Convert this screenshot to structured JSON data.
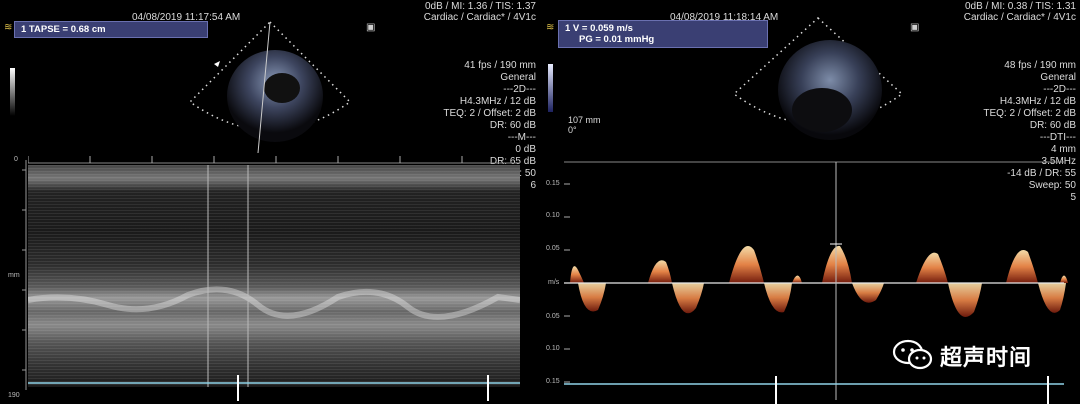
{
  "left": {
    "date": "04/08/2019 11:17:54 AM",
    "header_right": [
      "0dB / MI: 1.36 / TIS: 1.37",
      "Cardiac / Cardiac* / 4V1c"
    ],
    "measurement": "1  TAPSE = 0.68 cm",
    "params": [
      "41 fps / 190 mm",
      "General",
      "---2D---",
      "H4.3MHz / 12 dB",
      "TEQ: 2 / Offset: 2 dB",
      "DR: 60 dB",
      "---M---",
      "0 dB",
      "DR: 65 dB",
      "Sweep: 50",
      "6"
    ],
    "depth_top": "0",
    "depth_unit": "mm",
    "depth_bottom": "190"
  },
  "right": {
    "date": "04/08/2019 11:18:14 AM",
    "header_right": [
      "0dB / MI: 0.38 / TIS: 1.31",
      "Cardiac / Cardiac* / 4V1c"
    ],
    "measurement_line1": "1  V = 0.059 m/s",
    "measurement_line2": "PG = 0.01 mmHg",
    "depth_label": "107 mm",
    "angle_label": "0°",
    "params": [
      "48 fps / 190 mm",
      "General",
      "---2D---",
      "H4.3MHz / 12 dB",
      "TEQ: 2 / Offset: 2 dB",
      "DR: 60 dB",
      "---DTI---",
      "4 mm",
      "3.5MHz",
      "-14 dB / DR: 55",
      "Sweep: 50",
      "5"
    ],
    "scale": [
      "0.15",
      "0.10",
      "0.05",
      "m/s",
      "0.05",
      "0.10",
      "0.15"
    ]
  },
  "watermark": "超声时间",
  "colors": {
    "meas_box": "#3a3f73",
    "doppler": "#f08a4b",
    "baseline": "#8fd3e8"
  }
}
